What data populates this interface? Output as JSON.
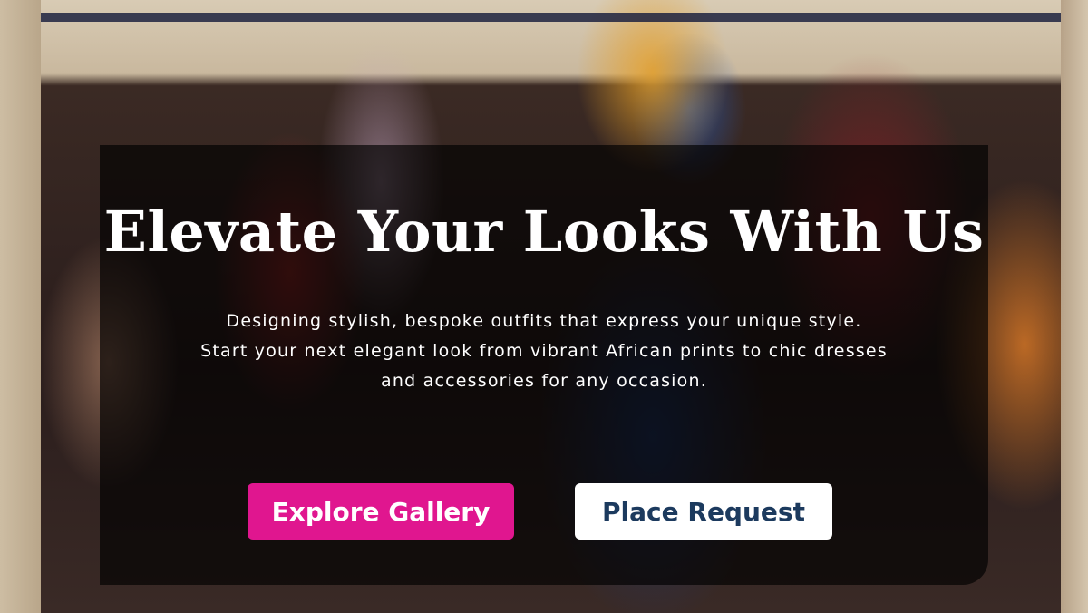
{
  "hero": {
    "headline": "Elevate Your Looks With Us",
    "subtitle": "Designing stylish, bespoke outfits that express your unique style. Start your next elegant look from vibrant African prints to chic dresses and accessories for any occasion.",
    "primary_button_label": "Explore Gallery",
    "secondary_button_label": "Place Request"
  },
  "colors": {
    "primary_button": "#e0168f",
    "secondary_button_text": "#1c3a5e",
    "overlay": "rgba(0,0,0,0.66)"
  }
}
